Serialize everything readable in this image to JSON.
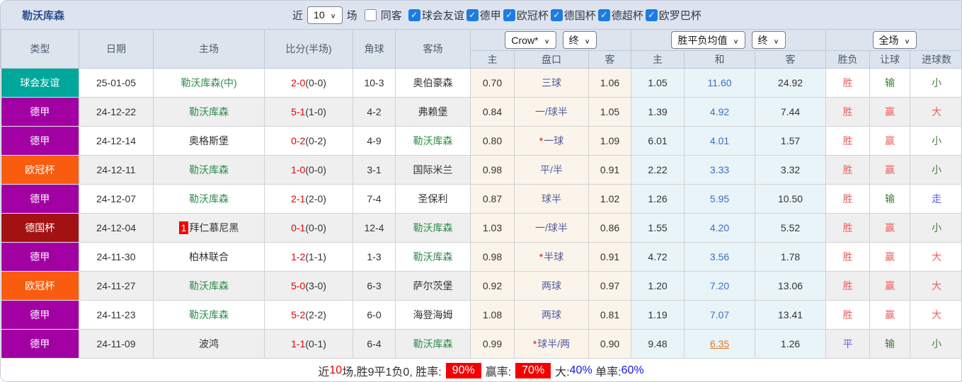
{
  "title": "勒沃库森",
  "topbar": {
    "recent_label": "近",
    "recent_value": "10",
    "games_label": "场",
    "same_away_label": "同客",
    "same_away_checked": false,
    "leagues": [
      {
        "label": "球会友谊",
        "checked": true
      },
      {
        "label": "德甲",
        "checked": true
      },
      {
        "label": "欧冠杯",
        "checked": true
      },
      {
        "label": "德国杯",
        "checked": true
      },
      {
        "label": "德超杯",
        "checked": true
      },
      {
        "label": "欧罗巴杯",
        "checked": true
      }
    ]
  },
  "table": {
    "headers": {
      "type": "类型",
      "date": "日期",
      "home": "主场",
      "score": "比分(半场)",
      "corner": "角球",
      "away": "客场",
      "odds_home": "主",
      "odds_handicap": "盘口",
      "odds_away": "客",
      "avg_home": "主",
      "avg_draw": "和",
      "avg_away": "客",
      "result_wl": "胜负",
      "result_handicap": "让球",
      "result_goals": "进球数"
    },
    "dropdowns": {
      "bookmaker": "Crow*",
      "bookmaker_time": "终",
      "avg": "胜平负均值",
      "avg_time": "终",
      "period": "全场"
    }
  },
  "colors": {
    "league": {
      "friendly": "#00a79b",
      "bundesliga": "#a300a3",
      "ucl": "#f95c0f",
      "dfb_pokal": "#a31212"
    }
  },
  "rows": [
    {
      "league": "球会友谊",
      "league_color": "friendly",
      "date": "25-01-05",
      "home": "勒沃库森(中)",
      "home_green": true,
      "score": "2-0",
      "half": "(0-0)",
      "corner": "10-3",
      "away": "奥伯豪森",
      "away_green": false,
      "odds_home": "0.70",
      "handicap": "三球",
      "odds_away": "1.06",
      "avg_home": "1.05",
      "avg_draw": "11.60",
      "avg_away": "24.92",
      "r_wl": "胜",
      "r_wl_c": "red",
      "r_handicap": "输",
      "r_handicap_c": "green",
      "r_goals": "小",
      "r_goals_c": "green"
    },
    {
      "league": "德甲",
      "league_color": "bundesliga",
      "date": "24-12-22",
      "home": "勒沃库森",
      "home_green": true,
      "score": "5-1",
      "half": "(1-0)",
      "corner": "4-2",
      "away": "弗赖堡",
      "away_green": false,
      "odds_home": "0.84",
      "handicap": "一/球半",
      "odds_away": "1.05",
      "avg_home": "1.39",
      "avg_draw": "4.92",
      "avg_away": "7.44",
      "r_wl": "胜",
      "r_wl_c": "red",
      "r_handicap": "赢",
      "r_handicap_c": "red",
      "r_goals": "大",
      "r_goals_c": "red"
    },
    {
      "league": "德甲",
      "league_color": "bundesliga",
      "date": "24-12-14",
      "home": "奥格斯堡",
      "home_green": false,
      "score": "0-2",
      "half": "(0-2)",
      "corner": "4-9",
      "away": "勒沃库森",
      "away_green": true,
      "odds_home": "0.80",
      "handicap_star": "*",
      "handicap": "一球",
      "odds_away": "1.09",
      "avg_home": "6.01",
      "avg_draw": "4.01",
      "avg_away": "1.57",
      "r_wl": "胜",
      "r_wl_c": "red",
      "r_handicap": "赢",
      "r_handicap_c": "red",
      "r_goals": "小",
      "r_goals_c": "green"
    },
    {
      "league": "欧冠杯",
      "league_color": "ucl",
      "date": "24-12-11",
      "home": "勒沃库森",
      "home_green": true,
      "score": "1-0",
      "half": "(0-0)",
      "corner": "3-1",
      "away": "国际米兰",
      "away_green": false,
      "odds_home": "0.98",
      "handicap": "平/半",
      "odds_away": "0.91",
      "avg_home": "2.22",
      "avg_draw": "3.33",
      "avg_away": "3.32",
      "r_wl": "胜",
      "r_wl_c": "red",
      "r_handicap": "赢",
      "r_handicap_c": "red",
      "r_goals": "小",
      "r_goals_c": "green"
    },
    {
      "league": "德甲",
      "league_color": "bundesliga",
      "date": "24-12-07",
      "home": "勒沃库森",
      "home_green": true,
      "score": "2-1",
      "half": "(2-0)",
      "corner": "7-4",
      "away": "圣保利",
      "away_green": false,
      "odds_home": "0.87",
      "handicap": "球半",
      "odds_away": "1.02",
      "avg_home": "1.26",
      "avg_draw": "5.95",
      "avg_away": "10.50",
      "r_wl": "胜",
      "r_wl_c": "red",
      "r_handicap": "输",
      "r_handicap_c": "green",
      "r_goals": "走",
      "r_goals_c": "blue"
    },
    {
      "league": "德国杯",
      "league_color": "dfb_pokal",
      "date": "24-12-04",
      "home_badge": "1",
      "home": "拜仁慕尼黑",
      "home_green": false,
      "score": "0-1",
      "half": "(0-0)",
      "corner": "12-4",
      "away": "勒沃库森",
      "away_green": true,
      "odds_home": "1.03",
      "handicap": "一/球半",
      "odds_away": "0.86",
      "avg_home": "1.55",
      "avg_draw": "4.20",
      "avg_away": "5.52",
      "r_wl": "胜",
      "r_wl_c": "red",
      "r_handicap": "赢",
      "r_handicap_c": "red",
      "r_goals": "小",
      "r_goals_c": "green"
    },
    {
      "league": "德甲",
      "league_color": "bundesliga",
      "date": "24-11-30",
      "home": "柏林联合",
      "home_green": false,
      "score": "1-2",
      "half": "(1-1)",
      "corner": "1-3",
      "away": "勒沃库森",
      "away_green": true,
      "odds_home": "0.98",
      "handicap_star": "*",
      "handicap": "半球",
      "odds_away": "0.91",
      "avg_home": "4.72",
      "avg_draw": "3.56",
      "avg_away": "1.78",
      "r_wl": "胜",
      "r_wl_c": "red",
      "r_handicap": "赢",
      "r_handicap_c": "red",
      "r_goals": "大",
      "r_goals_c": "red"
    },
    {
      "league": "欧冠杯",
      "league_color": "ucl",
      "date": "24-11-27",
      "home": "勒沃库森",
      "home_green": true,
      "score": "5-0",
      "half": "(3-0)",
      "corner": "6-3",
      "away": "萨尔茨堡",
      "away_green": false,
      "odds_home": "0.92",
      "handicap": "两球",
      "odds_away": "0.97",
      "avg_home": "1.20",
      "avg_draw": "7.20",
      "avg_away": "13.06",
      "r_wl": "胜",
      "r_wl_c": "red",
      "r_handicap": "赢",
      "r_handicap_c": "red",
      "r_goals": "大",
      "r_goals_c": "red"
    },
    {
      "league": "德甲",
      "league_color": "bundesliga",
      "date": "24-11-23",
      "home": "勒沃库森",
      "home_green": true,
      "score": "5-2",
      "half": "(2-2)",
      "corner": "6-0",
      "away": "海登海姆",
      "away_green": false,
      "odds_home": "1.08",
      "handicap": "两球",
      "odds_away": "0.81",
      "avg_home": "1.19",
      "avg_draw": "7.07",
      "avg_away": "13.41",
      "r_wl": "胜",
      "r_wl_c": "red",
      "r_handicap": "赢",
      "r_handicap_c": "red",
      "r_goals": "大",
      "r_goals_c": "red"
    },
    {
      "league": "德甲",
      "league_color": "bundesliga",
      "date": "24-11-09",
      "home": "波鸿",
      "home_green": false,
      "score": "1-1",
      "half": "(0-1)",
      "corner": "6-4",
      "away": "勒沃库森",
      "away_green": true,
      "odds_home": "0.99",
      "handicap_star": "*",
      "handicap": "球半/两",
      "odds_away": "0.90",
      "avg_home": "9.48",
      "avg_draw": "6.35",
      "draw_hot": true,
      "avg_away": "1.26",
      "r_wl": "平",
      "r_wl_c": "blue",
      "r_handicap": "输",
      "r_handicap_c": "green",
      "r_goals": "小",
      "r_goals_c": "green"
    }
  ],
  "summary": {
    "prefix": "近",
    "count": "10",
    "middle": "场,胜9平1负0, 胜率:",
    "win_rate": "90%",
    "profit_label": "赢率:",
    "profit_rate": "70%",
    "big_label": "大:",
    "big_value": "40%",
    "single_label": " 单率:",
    "single_value": "60%"
  }
}
